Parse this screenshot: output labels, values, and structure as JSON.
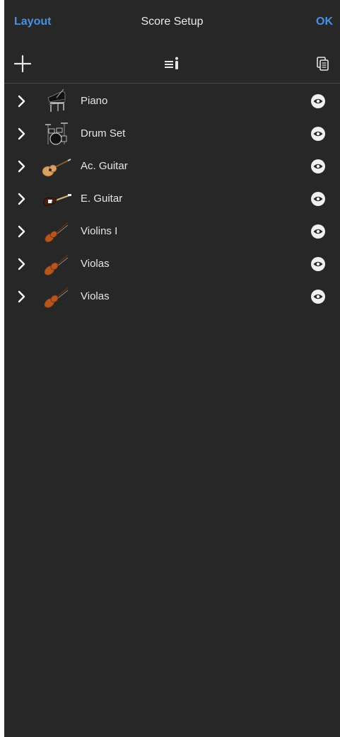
{
  "navbar": {
    "left_label": "Layout",
    "title": "Score Setup",
    "right_label": "OK"
  },
  "toolbar": {
    "add_icon": "plus-icon",
    "info_icon": "list-info-icon",
    "copy_icon": "copy-document-icon"
  },
  "colors": {
    "background": "#272727",
    "accent": "#4a90e2",
    "text": "#e6e6e6"
  },
  "instruments": [
    {
      "name": "Piano",
      "icon": "grand-piano-icon"
    },
    {
      "name": "Drum Set",
      "icon": "drum-set-icon"
    },
    {
      "name": "Ac. Guitar",
      "icon": "acoustic-guitar-icon"
    },
    {
      "name": "E. Guitar",
      "icon": "electric-guitar-icon"
    },
    {
      "name": "Violins I",
      "icon": "violin-icon"
    },
    {
      "name": "Violas",
      "icon": "viola-icon"
    },
    {
      "name": "Violas",
      "icon": "viola-icon"
    }
  ]
}
